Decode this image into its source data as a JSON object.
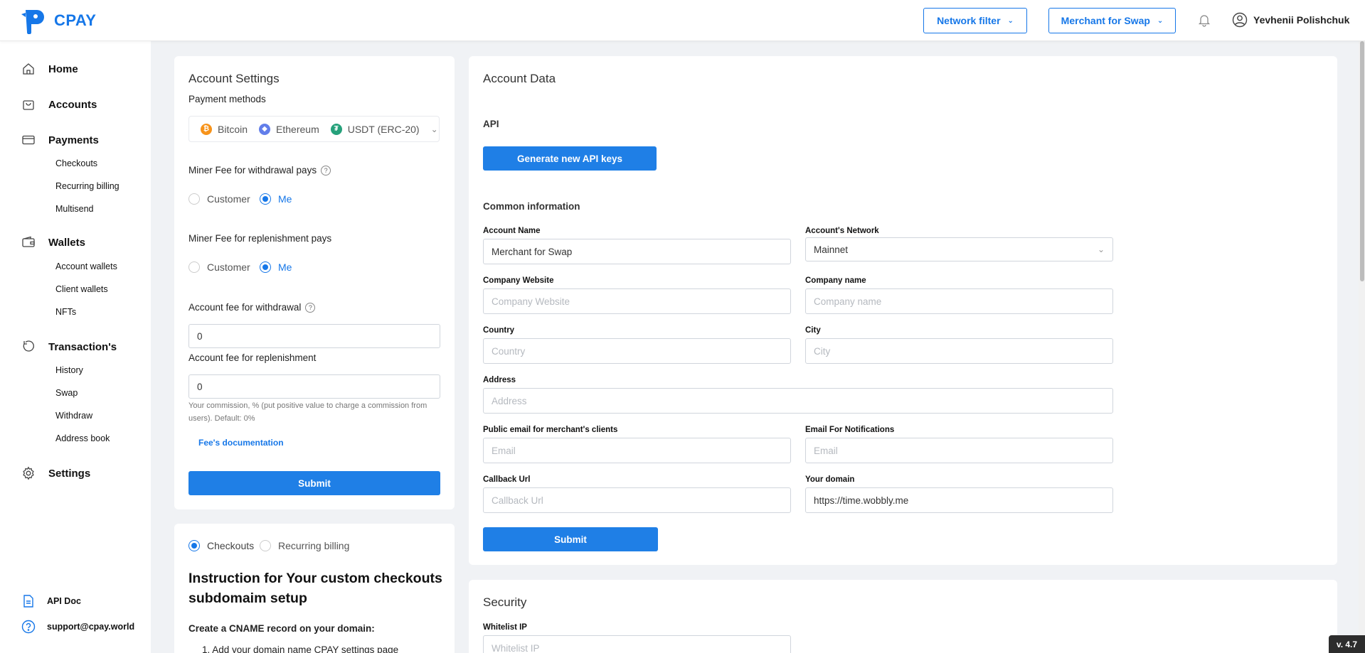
{
  "header": {
    "brand": "CPAY",
    "network_filter": "Network filter",
    "merchant_select": "Merchant for Swap",
    "user_name": "Yevhenii Polishchuk"
  },
  "sidebar": {
    "home": "Home",
    "accounts": "Accounts",
    "payments": "Payments",
    "checkouts": "Checkouts",
    "recurring_billing": "Recurring billing",
    "multisend": "Multisend",
    "wallets": "Wallets",
    "account_wallets": "Account wallets",
    "client_wallets": "Client wallets",
    "nfts": "NFTs",
    "transactions": "Transaction's",
    "history": "History",
    "swap": "Swap",
    "withdraw": "Withdraw",
    "address_book": "Address book",
    "settings": "Settings",
    "api_doc": "API Doc",
    "support": "support@cpay.world"
  },
  "account_settings": {
    "title": "Account Settings",
    "payment_methods_label": "Payment methods",
    "payment_methods": [
      "Bitcoin",
      "Ethereum",
      "USDT (ERC-20)"
    ],
    "miner_fee_withdrawal_label": "Miner Fee for withdrawal pays",
    "miner_fee_replenishment_label": "Miner Fee for replenishment pays",
    "opt_customer": "Customer",
    "opt_me": "Me",
    "fee_withdrawal_label": "Account fee for withdrawal",
    "fee_withdrawal_value": "0",
    "fee_replenishment_label": "Account fee for replenishment",
    "fee_replenishment_value": "0",
    "commission_hint": "Your commission, % (put positive value to charge a commission from users). Default: 0%",
    "fees_doc_link": "Fee's documentation",
    "submit": "Submit"
  },
  "checkout_setup": {
    "opt_checkouts": "Checkouts",
    "opt_recurring": "Recurring billing",
    "heading": "Instruction for Your custom checkouts subdomaim setup",
    "step_intro": "Create a CNAME record on your domain:",
    "step_1": "1. Add your domain name CPAY settings page"
  },
  "account_data": {
    "title": "Account Data",
    "api_label": "API",
    "generate_keys": "Generate new API keys",
    "common_info": "Common information",
    "account_name_label": "Account Name",
    "account_name_value": "Merchant for Swap",
    "network_label": "Account's Network",
    "network_value": "Mainnet",
    "website_label": "Company Website",
    "website_placeholder": "Company Website",
    "company_label": "Company name",
    "company_placeholder": "Company name",
    "country_label": "Country",
    "country_placeholder": "Country",
    "city_label": "City",
    "city_placeholder": "City",
    "address_label": "Address",
    "address_placeholder": "Address",
    "public_email_label": "Public email for merchant's clients",
    "email_placeholder": "Email",
    "notif_email_label": "Email For Notifications",
    "callback_label": "Callback Url",
    "callback_placeholder": "Callback Url",
    "domain_label": "Your domain",
    "domain_value": "https://time.wobbly.me",
    "submit": "Submit"
  },
  "security": {
    "title": "Security",
    "whitelist_label": "Whitelist IP",
    "whitelist_placeholder": "Whitelist IP"
  },
  "version": "v. 4.7",
  "colors": {
    "accent": "#1f7fe6",
    "bitcoin": "#f7931a",
    "ethereum": "#627eea",
    "usdt": "#26a17b"
  }
}
